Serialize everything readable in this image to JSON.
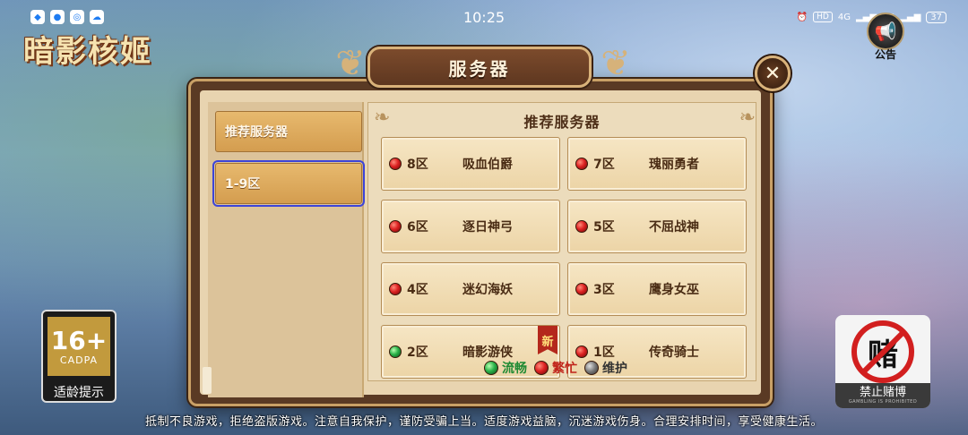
{
  "status_bar": {
    "time": "10:25",
    "network_1": "4G",
    "network_2": "4G",
    "hd": "HD",
    "battery": "37",
    "apps": [
      "app-icon-1",
      "app-icon-2",
      "app-icon-3",
      "app-icon-4"
    ]
  },
  "game": {
    "logo_text": "暗影核姬",
    "notice_label": "公告"
  },
  "dialog": {
    "title": "服务器",
    "close_glyph": "✕"
  },
  "tabs": [
    {
      "label": "推荐服务器",
      "selected": false
    },
    {
      "label": "1-9区",
      "selected": true
    }
  ],
  "panel": {
    "title": "推荐服务器",
    "servers": [
      {
        "zone": "8区",
        "name": "吸血伯爵",
        "status": "red"
      },
      {
        "zone": "7区",
        "name": "瑰丽勇者",
        "status": "red"
      },
      {
        "zone": "6区",
        "name": "逐日神弓",
        "status": "red"
      },
      {
        "zone": "5区",
        "name": "不屈战神",
        "status": "red"
      },
      {
        "zone": "4区",
        "name": "迷幻海妖",
        "status": "red"
      },
      {
        "zone": "3区",
        "name": "鹰身女巫",
        "status": "red"
      },
      {
        "zone": "2区",
        "name": "暗影游侠",
        "status": "green",
        "new": "新"
      },
      {
        "zone": "1区",
        "name": "传奇骑士",
        "status": "red"
      }
    ]
  },
  "legend": {
    "smooth": "流畅",
    "busy": "繁忙",
    "maintenance": "维护"
  },
  "badges": {
    "age_number": "16+",
    "age_org": "CADPA",
    "age_label": "适龄提示",
    "gamble_sign": "赌",
    "gamble_label": "禁止赌博",
    "gamble_sub": "GAMBLING IS PROHIBITED"
  },
  "footer": {
    "text": "抵制不良游戏，拒绝盗版游戏。注意自我保护，谨防受骗上当。适度游戏益脑，沉迷游戏伤身。合理安排时间，享受健康生活。"
  },
  "colors": {
    "green": "#2bb34a",
    "red": "#d22222",
    "gray": "#777777",
    "dialog_frame": "#5a3a24",
    "selected_outline": "#3d44d8"
  }
}
